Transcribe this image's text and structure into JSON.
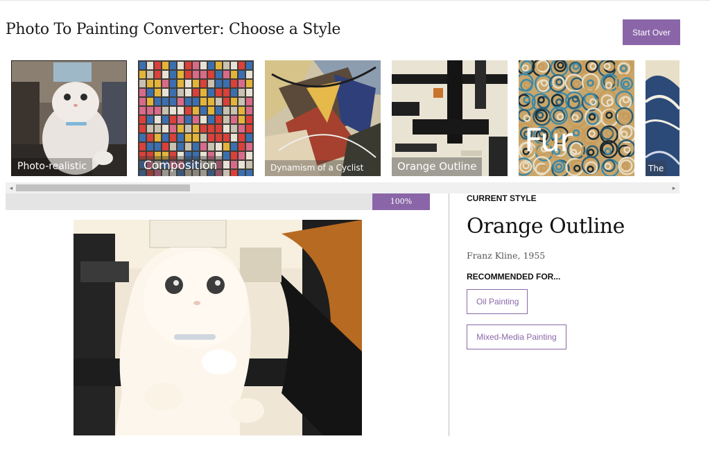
{
  "header": {
    "title": "Photo To Painting Converter: Choose a Style",
    "start_over_label": "Start Over"
  },
  "styles": [
    {
      "label": "Photo-realistic",
      "selected_outline": true
    },
    {
      "label": "Composition"
    },
    {
      "label": "Dynamism of a Cyclist"
    },
    {
      "label": "Orange Outline"
    },
    {
      "label": "Fur"
    },
    {
      "label": "The"
    }
  ],
  "progress": {
    "percent": 100,
    "label": "100%"
  },
  "current_style": {
    "eyebrow": "CURRENT STYLE",
    "name": "Orange Outline",
    "artist": "Franz Kline, 1955",
    "recommended_heading": "RECOMMENDED FOR...",
    "recommended": [
      "Oil Painting",
      "Mixed-Media Painting"
    ]
  },
  "colors": {
    "accent": "#8a66a8",
    "scroll_track": "#f0f0f0",
    "progress_track": "#e4e4e4"
  }
}
